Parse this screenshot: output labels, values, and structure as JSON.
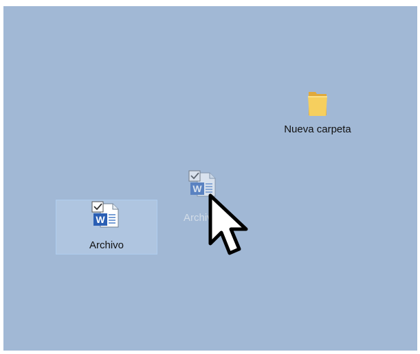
{
  "desktop": {
    "background_color": "#a1b8d5",
    "items": [
      {
        "label": "Nueva carpeta",
        "icon": "folder-icon"
      },
      {
        "label": "Archivo",
        "icon": "word-document-icon",
        "selected": true
      }
    ],
    "drag": {
      "label": "Archivo",
      "icon": "word-document-icon"
    },
    "cursor": "arrow-cursor-icon"
  }
}
